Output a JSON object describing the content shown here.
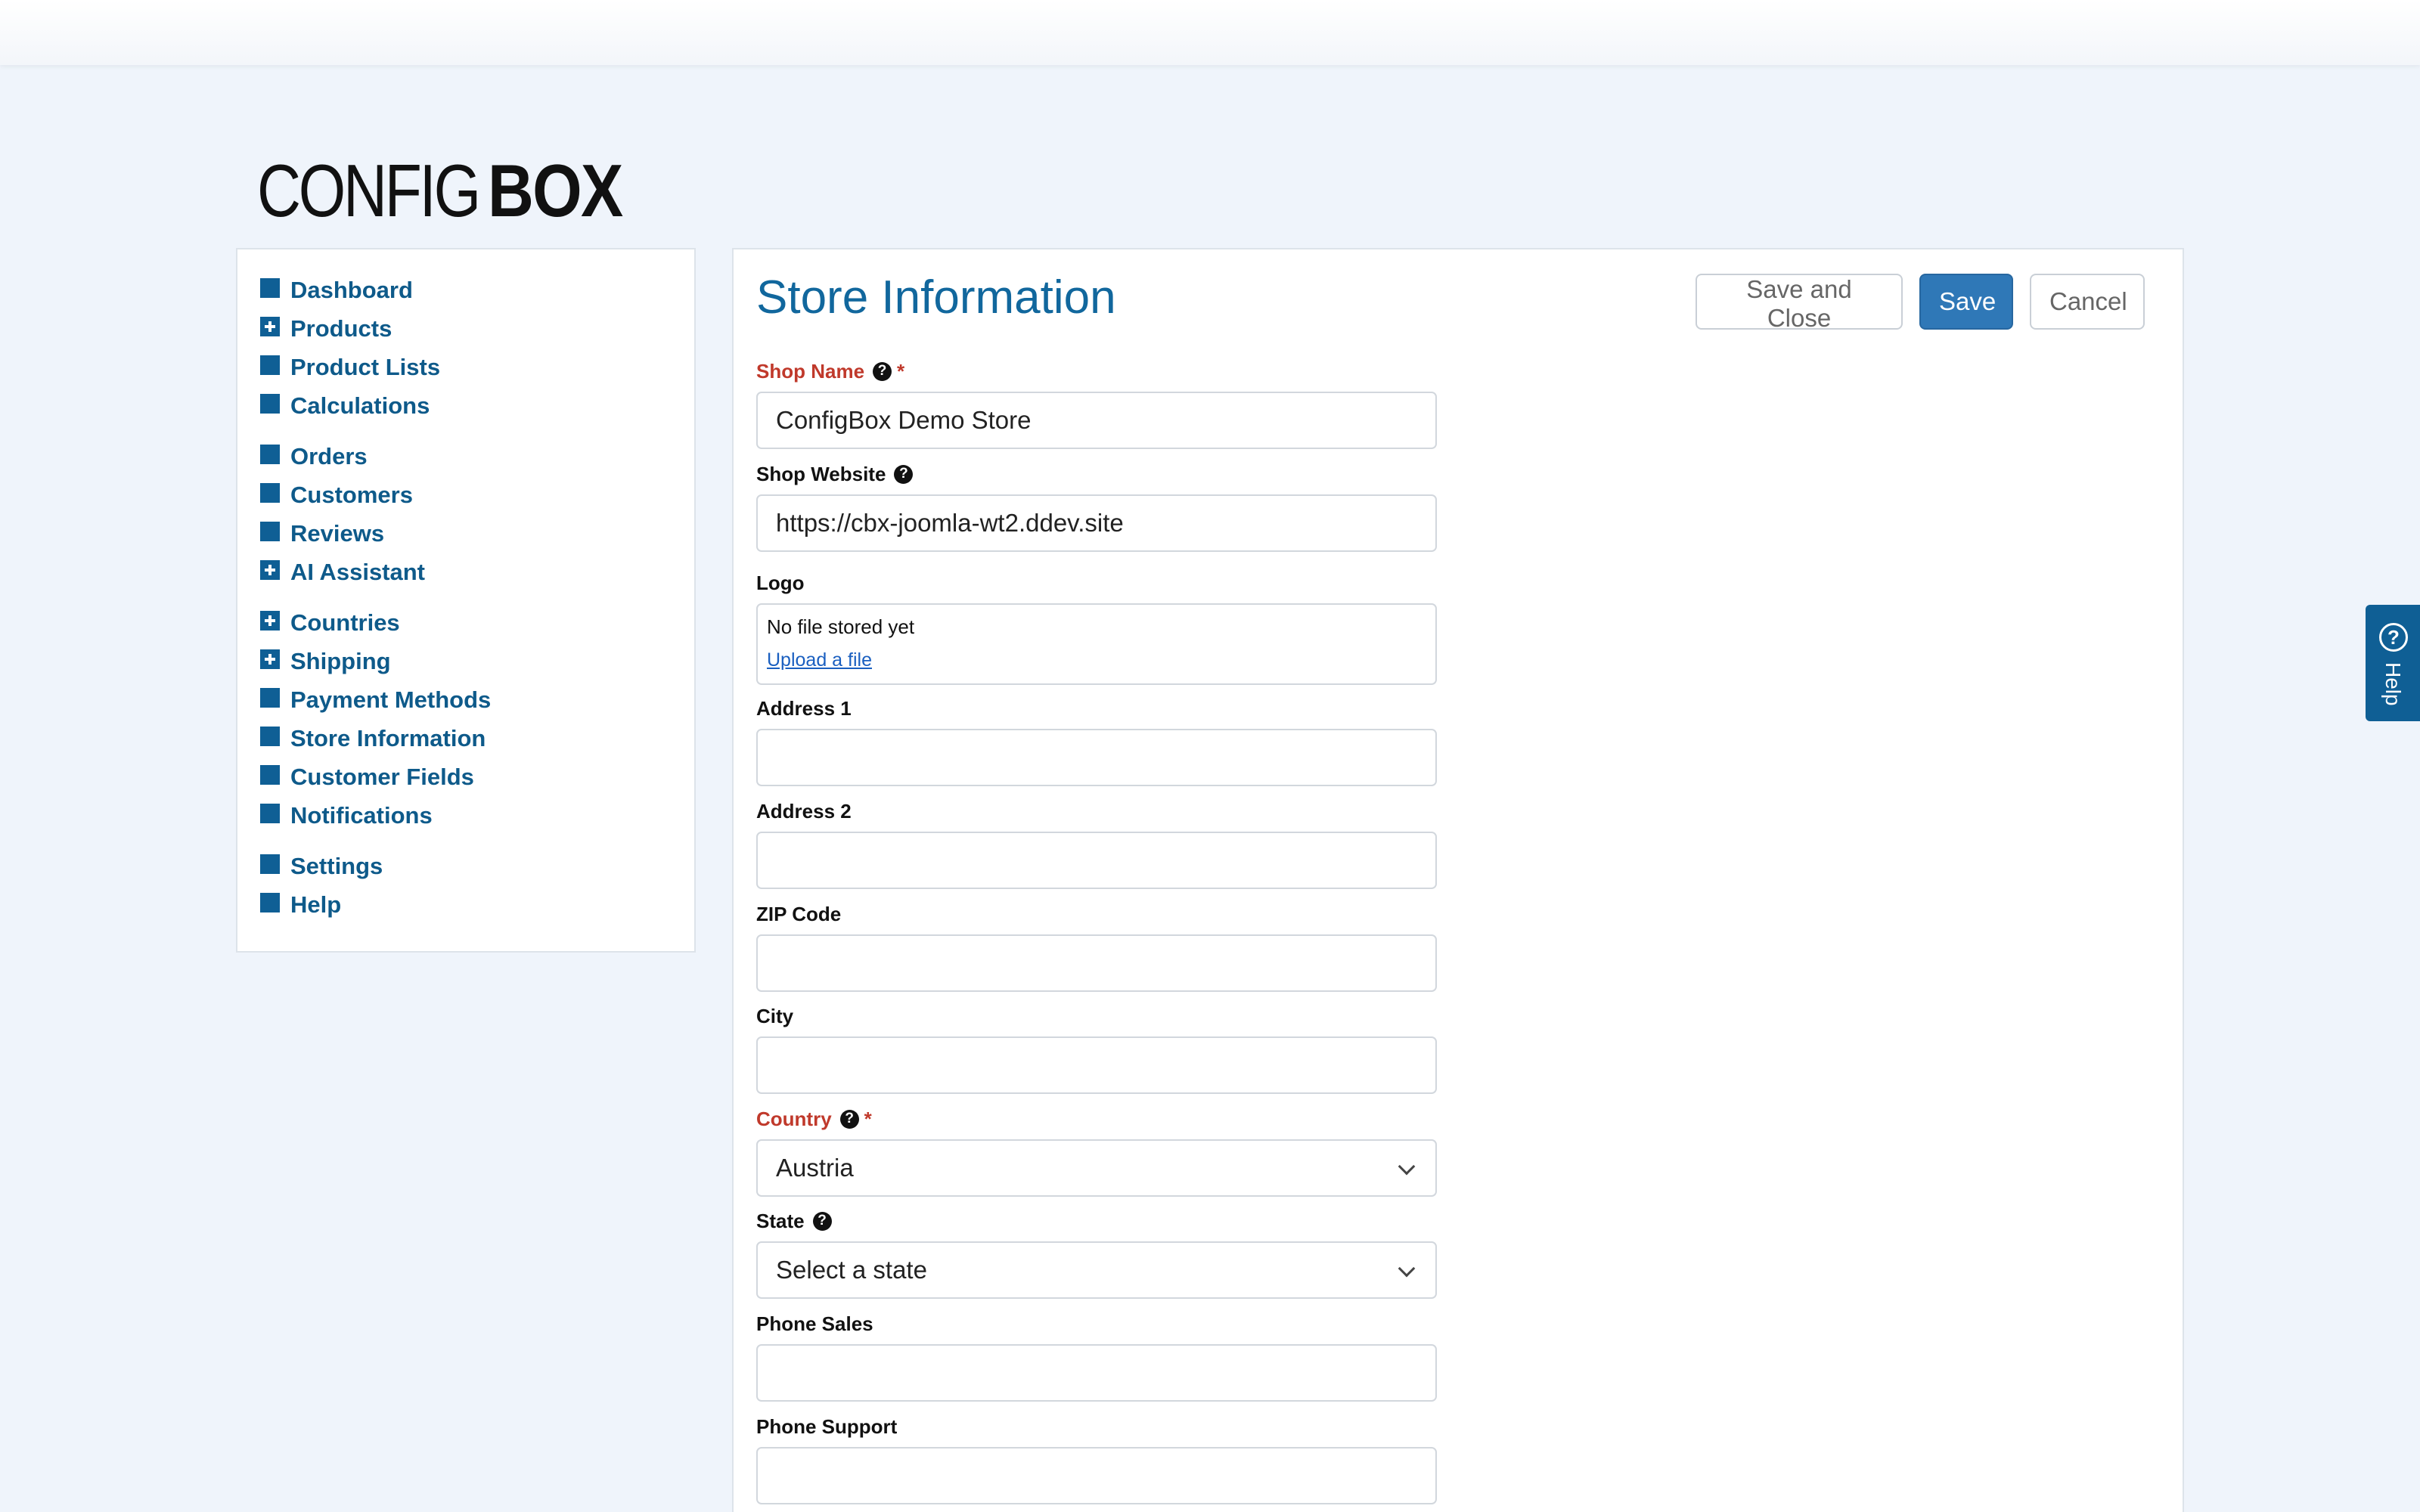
{
  "logo": {
    "light": "CONFIG",
    "bold": "BOX"
  },
  "sidebar": {
    "groups": [
      [
        {
          "label": "Dashboard",
          "expandable": false
        },
        {
          "label": "Products",
          "expandable": true
        },
        {
          "label": "Product Lists",
          "expandable": false
        },
        {
          "label": "Calculations",
          "expandable": false
        }
      ],
      [
        {
          "label": "Orders",
          "expandable": false
        },
        {
          "label": "Customers",
          "expandable": false
        },
        {
          "label": "Reviews",
          "expandable": false
        },
        {
          "label": "AI Assistant",
          "expandable": true
        }
      ],
      [
        {
          "label": "Countries",
          "expandable": true
        },
        {
          "label": "Shipping",
          "expandable": true
        },
        {
          "label": "Payment Methods",
          "expandable": false
        },
        {
          "label": "Store Information",
          "expandable": false
        },
        {
          "label": "Customer Fields",
          "expandable": false
        },
        {
          "label": "Notifications",
          "expandable": false
        }
      ],
      [
        {
          "label": "Settings",
          "expandable": false
        },
        {
          "label": "Help",
          "expandable": false
        }
      ]
    ]
  },
  "main": {
    "title": "Store Information",
    "toolbar": {
      "save_close_label": "Save and Close",
      "save_label": "Save",
      "cancel_label": "Cancel"
    },
    "form": {
      "shop_name": {
        "label": "Shop Name",
        "value": "ConfigBox Demo Store",
        "required_mark": "*"
      },
      "shop_website": {
        "label": "Shop Website",
        "value": "https://cbx-joomla-wt2.ddev.site"
      },
      "logo": {
        "label": "Logo",
        "status": "No file stored yet",
        "upload_link": "Upload a file"
      },
      "address1": {
        "label": "Address 1",
        "value": ""
      },
      "address2": {
        "label": "Address 2",
        "value": ""
      },
      "zip": {
        "label": "ZIP Code",
        "value": ""
      },
      "city": {
        "label": "City",
        "value": ""
      },
      "country": {
        "label": "Country",
        "value": "Austria",
        "required_mark": "*"
      },
      "state": {
        "label": "State",
        "value": "Select a state"
      },
      "phone_sales": {
        "label": "Phone Sales",
        "value": ""
      },
      "phone_support": {
        "label": "Phone Support",
        "value": ""
      }
    },
    "help_glyph": "?"
  },
  "help_tab": {
    "label": "Help",
    "glyph": "?"
  },
  "colors": {
    "accent": "#0f5f95",
    "title": "#11679d",
    "required": "#c0392b",
    "primary_button": "#2f78b7",
    "background": "#eff4fb"
  }
}
